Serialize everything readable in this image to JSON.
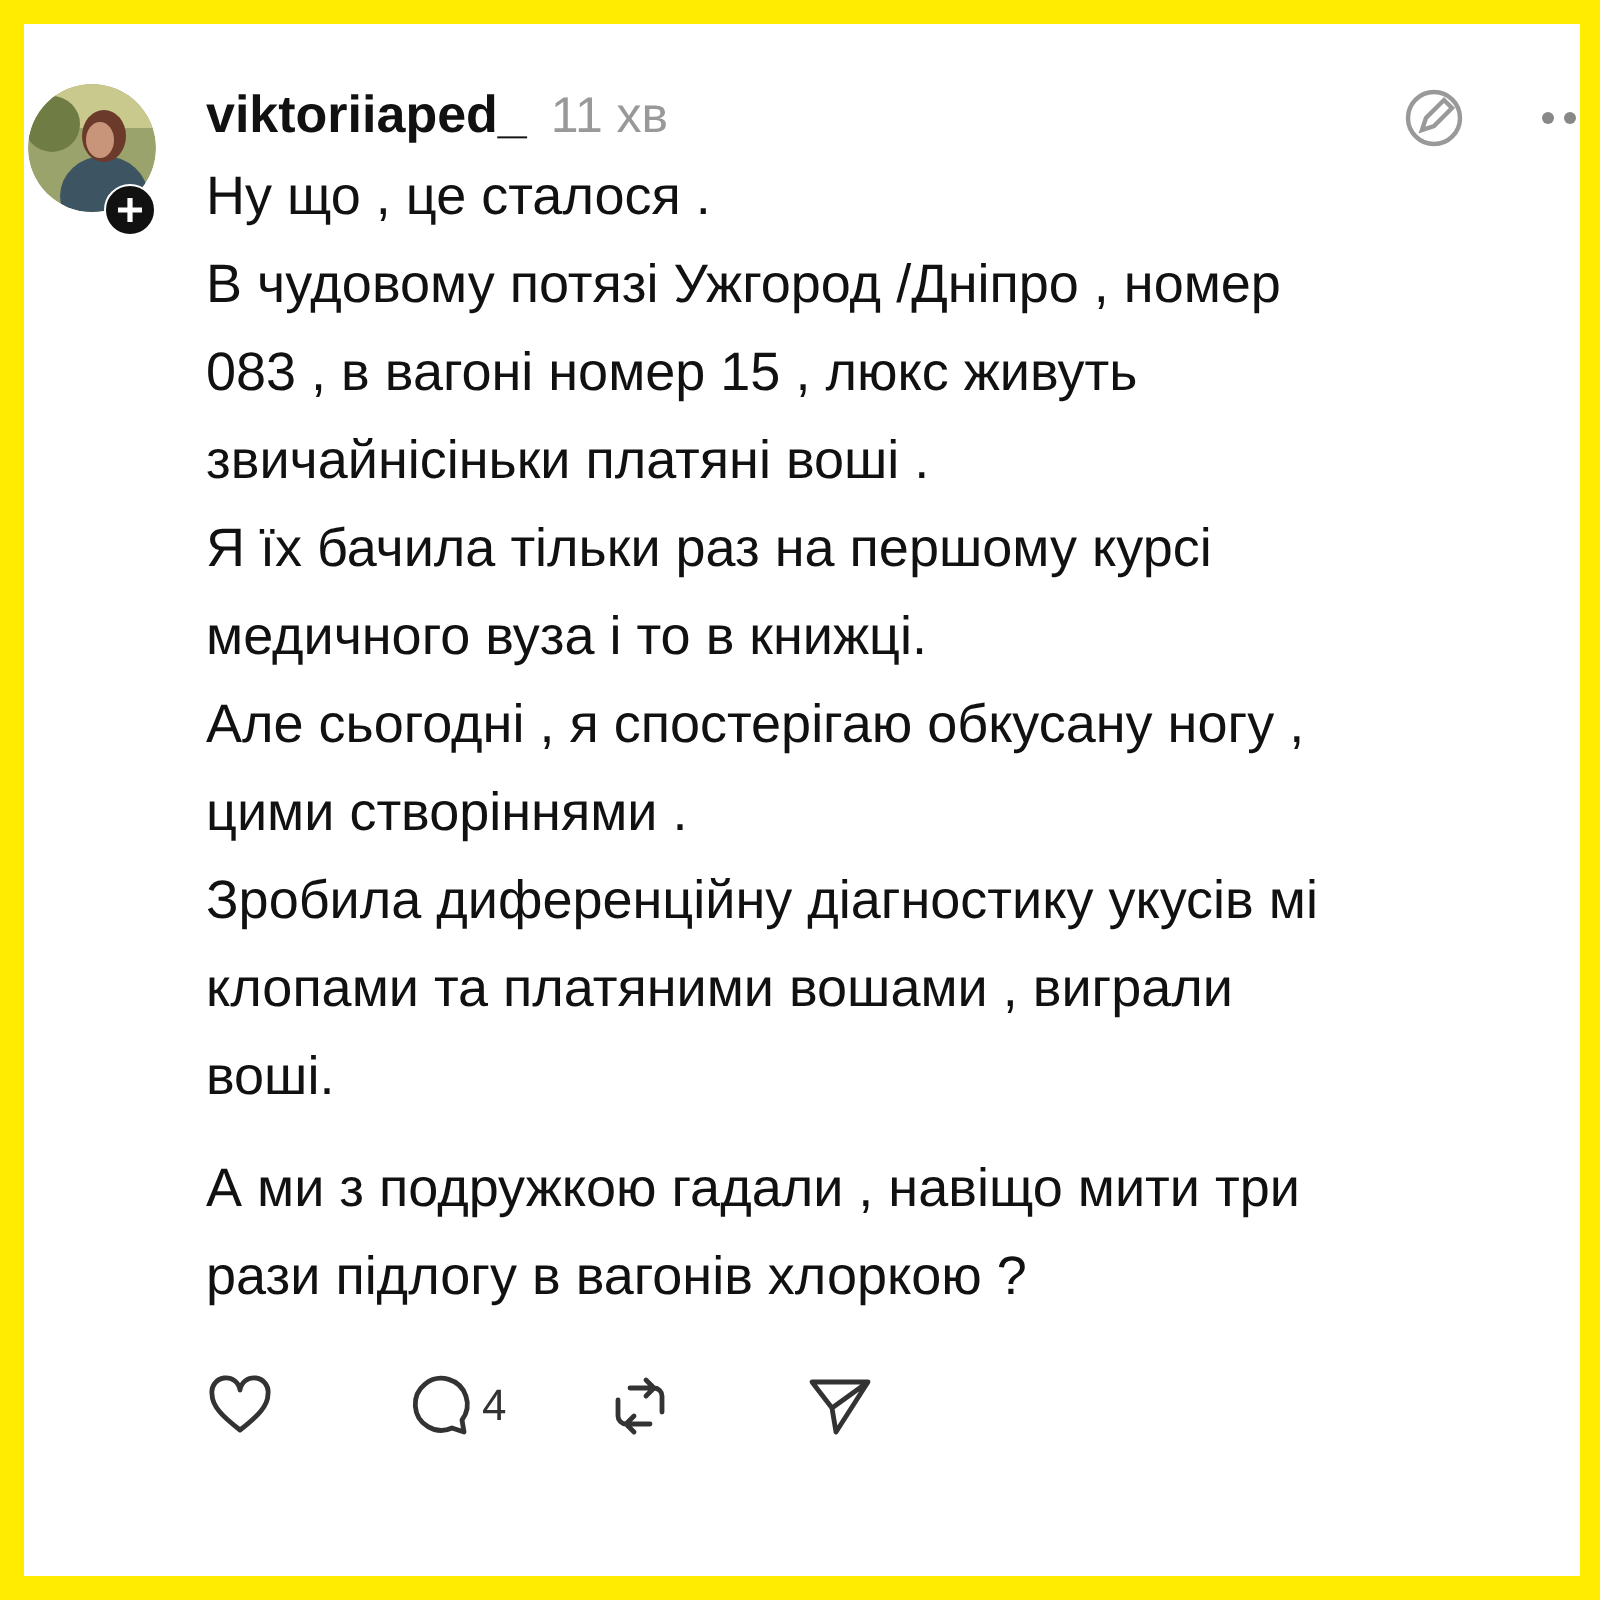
{
  "post": {
    "author": "viktoriiaped_",
    "time": "11 хв",
    "paragraphs": [
      [
        "Ну що , це сталося ."
      ],
      [
        "В чудовому  потязі Ужгород /Дніпро , номер",
        "083 , в вагоні номер 15 , люкс живуть",
        "звичайнісіньки платяні воші ."
      ],
      [
        "Я їх бачила тільки раз на першому курсі",
        "медичного вуза і то в книжці."
      ],
      [
        "Але сьогодні , я спостерігаю обкусану ногу ,",
        "цими створіннями ."
      ],
      [
        "Зробила диференційну діагностику укусів мі",
        "клопами та платяними вошами , виграли",
        "воші."
      ]
    ],
    "closing": [
      "А ми з подружкою гадали , навіщо мити три",
      "рази підлогу в вагонів хлоркою ?"
    ],
    "replies": "4"
  }
}
